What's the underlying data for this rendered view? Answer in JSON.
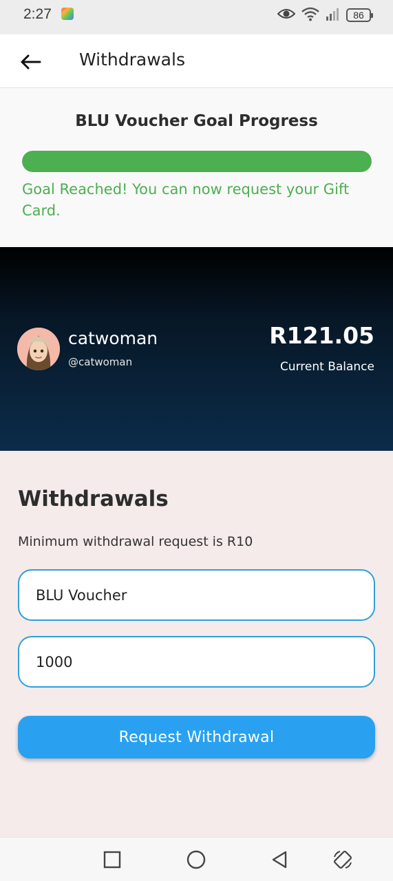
{
  "status_bar": {
    "time": "2:27",
    "battery": "86",
    "icons": [
      "app-notification-icon",
      "eye-icon",
      "wifi-icon",
      "signal-icon",
      "battery-icon"
    ]
  },
  "app_bar": {
    "title": "Withdrawals",
    "back_icon": "arrow-left-icon"
  },
  "goal": {
    "title": "BLU Voucher Goal Progress",
    "progress_fraction": 1.0,
    "message": "Goal Reached! You can now request your Gift Card.",
    "color": "#4caf50"
  },
  "profile": {
    "name": "catwoman",
    "handle": "@catwoman",
    "balance": "R121.05",
    "balance_label": "Current Balance"
  },
  "withdrawals": {
    "title": "Withdrawals",
    "min_note": "Minimum withdrawal request is R10",
    "voucher_type_value": "BLU Voucher",
    "amount_value": "1000",
    "button_label": "Request Withdrawal",
    "accent": "#29a1f0"
  },
  "nav_bar": {
    "items": [
      "recent-apps-icon",
      "home-icon",
      "back-icon",
      "rotate-screen-icon"
    ]
  }
}
